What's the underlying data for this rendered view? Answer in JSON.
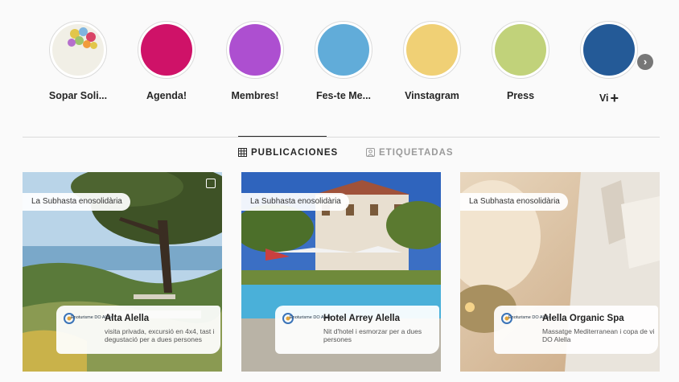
{
  "highlights": [
    {
      "label": "Sopar Soli...",
      "color": "#f1efe6",
      "icon": "balloons-image"
    },
    {
      "label": "Agenda!",
      "color": "#cf1268"
    },
    {
      "label": "Membres!",
      "color": "#ad4fd0"
    },
    {
      "label": "Fes-te Me...",
      "color": "#61acd9"
    },
    {
      "label": "Vinstagram",
      "color": "#f0d075"
    },
    {
      "label": "Press",
      "color": "#c1d27a"
    },
    {
      "label": "Vi",
      "color": "#245a97"
    }
  ],
  "next_icon": "chevron-right-icon",
  "tabs": [
    {
      "label": "PUBLICACIONES",
      "icon": "grid-icon"
    },
    {
      "label": "ETIQUETADAS",
      "icon": "tag-icon"
    }
  ],
  "posts": [
    {
      "tag": "La Subhasta enosolidària",
      "title": "Alta Alella",
      "desc": "visita privada, excursió en 4x4, tast i degustació per a dues persones"
    },
    {
      "tag": "La Subhasta enosolidària",
      "title": "Hotel Arrey Alella",
      "desc": "Nit d'hotel i esmorzar per a dues persones"
    },
    {
      "tag": "La Subhasta enosolidària",
      "title": "Alella Organic Spa",
      "desc": "Massatge Mediterranean i copa de vi DO Alella"
    }
  ],
  "logo_text": "Enoturisme DO Alella"
}
